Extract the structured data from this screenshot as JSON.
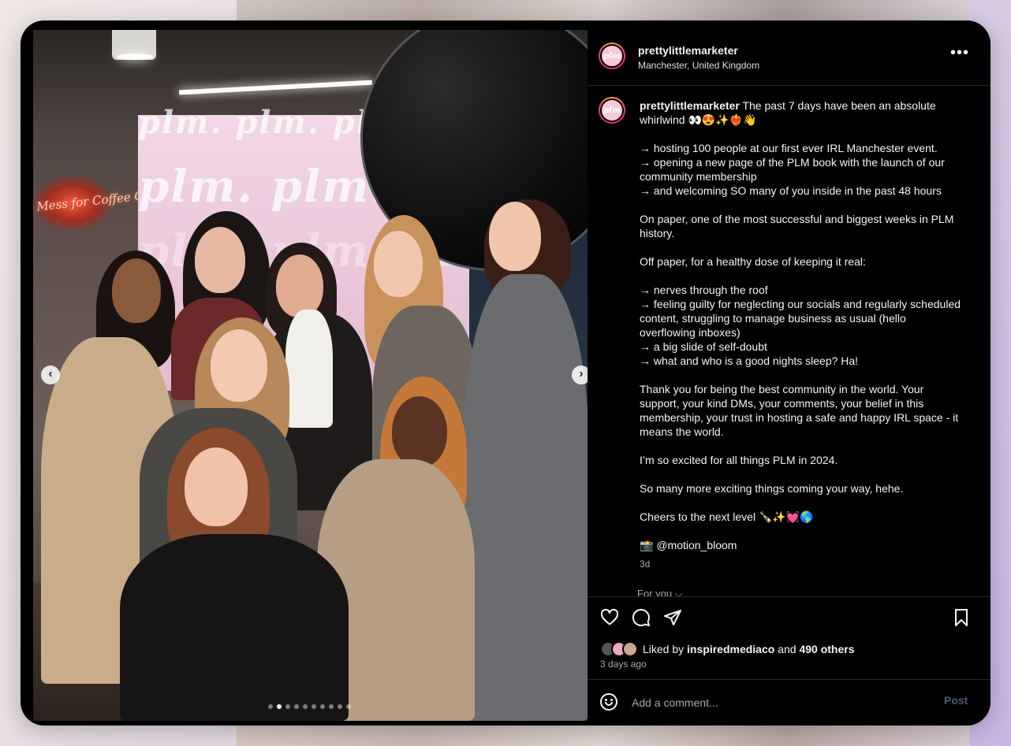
{
  "post": {
    "username": "prettylittlemarketer",
    "location": "Manchester, United Kingdom",
    "avatar_text": "plm",
    "caption_lines": [
      " The past 7 days have been an absolute whirlwind 👀😍✨❤️‍🔥👋",
      "",
      "→ hosting 100 people at our first ever IRL Manchester event.",
      "→ opening a new page of the PLM book with the launch of our community membership",
      "→ and welcoming SO many of you inside in the past 48 hours",
      "",
      "On paper, one of the most successful and biggest weeks in PLM history.",
      "",
      "Off paper, for a healthy dose of keeping it real:",
      "",
      "→ nerves through the roof",
      "→ feeling guilty for neglecting our socials and regularly scheduled content, struggling to manage business as usual (hello overflowing inboxes)",
      "→ a big slide of self-doubt",
      "→ what and who is a good nights sleep? Ha!",
      "",
      "Thank you for being the best community in the world. Your support, your kind DMs, your comments, your belief in this membership, your trust in hosting a safe and happy IRL space - it means the world.",
      "",
      "I’m so excited for all things PLM in 2024.",
      "",
      "So many more exciting things coming your way, hehe.",
      "",
      "Cheers to the next level 🍾✨💓🌎",
      "",
      "📸 @motion_bloom"
    ],
    "time_ago": "3d",
    "for_you": "For you ⌵"
  },
  "photo": {
    "backdrop_text": "plm. plm. plm.",
    "neon_text": "Mess for Coffee Culture",
    "slide_count": 10,
    "active_slide": 1
  },
  "likes": {
    "prefix": "Liked by ",
    "first_liker": "inspiredmediaco",
    "middle": " and ",
    "others": "490 others"
  },
  "date": "3 days ago",
  "comment": {
    "placeholder": "Add a comment...",
    "post_label": "Post"
  },
  "colors": {
    "background": "#000000",
    "text": "#f5f5f5",
    "muted": "#a8a8a8",
    "post_disabled": "#4a5d73",
    "divider": "#262626"
  },
  "icons": [
    "heart-icon",
    "comment-icon",
    "share-icon",
    "bookmark-icon",
    "emoji-icon",
    "more-icon",
    "chevron-left-icon",
    "chevron-right-icon"
  ]
}
